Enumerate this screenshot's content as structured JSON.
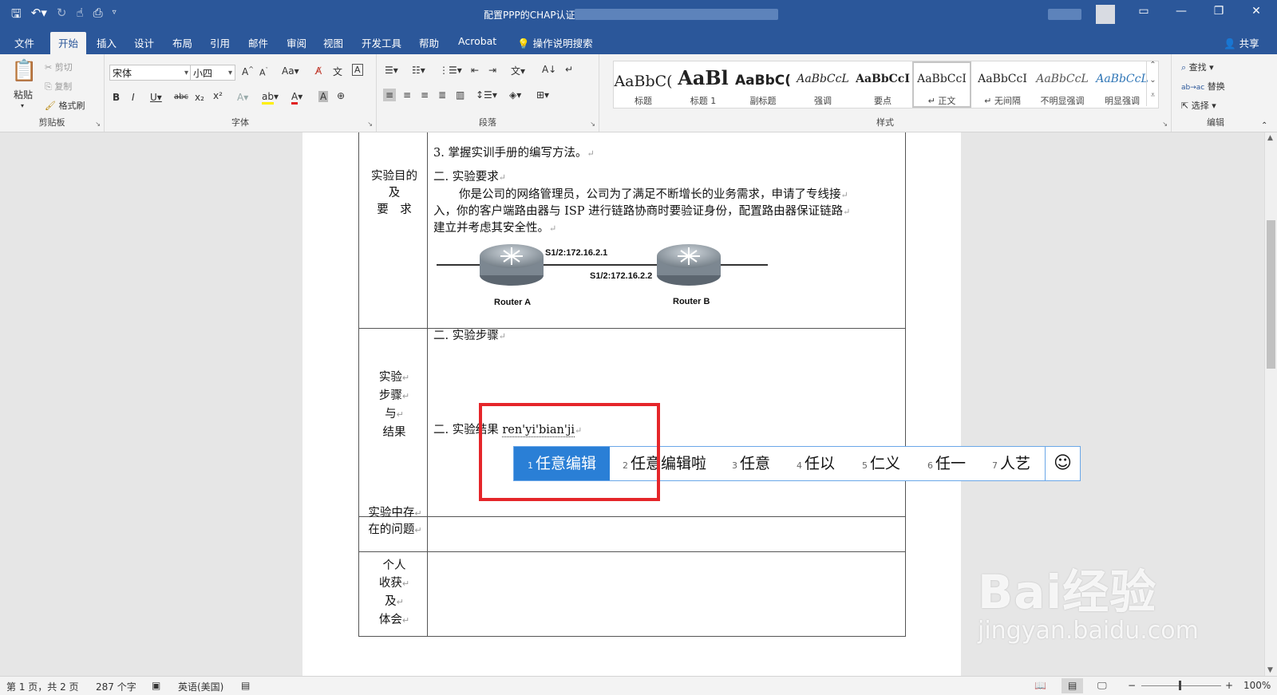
{
  "titlebar": {
    "title": "配置PPP的CHAP认证",
    "window_buttons": [
      "ribbon-display",
      "minimize",
      "restore",
      "close"
    ]
  },
  "tabs": [
    "文件",
    "开始",
    "插入",
    "设计",
    "布局",
    "引用",
    "邮件",
    "审阅",
    "视图",
    "开发工具",
    "帮助",
    "Acrobat"
  ],
  "active_tab": "开始",
  "tell_me": "操作说明搜索",
  "share": "共享",
  "ribbon": {
    "clipboard": {
      "name": "剪贴板",
      "paste": "粘贴",
      "cut": "剪切",
      "copy": "复制",
      "format_painter": "格式刷"
    },
    "font": {
      "name": "字体",
      "font_family": "宋体",
      "font_size": "小四",
      "change_case": "Aa"
    },
    "paragraph": {
      "name": "段落"
    },
    "styles": {
      "name": "样式",
      "items": [
        {
          "preview": "AaBbC(",
          "label": "标题"
        },
        {
          "preview": "AaBl",
          "label": "标题 1"
        },
        {
          "preview": "AaBbC(",
          "label": "副标题"
        },
        {
          "preview": "AaBbCcL",
          "label": "强调"
        },
        {
          "preview": "AaBbCcI",
          "label": "要点"
        },
        {
          "preview": "AaBbCcI",
          "label": "↵ 正文"
        },
        {
          "preview": "AaBbCcI",
          "label": "↵ 无间隔"
        },
        {
          "preview": "AaBbCcL",
          "label": "不明显强调"
        },
        {
          "preview": "AaBbCcL",
          "label": "明显强调"
        }
      ]
    },
    "editing": {
      "name": "编辑",
      "find": "查找",
      "replace": "替换",
      "select": "选择"
    }
  },
  "document": {
    "row1_label": [
      "实验目的",
      "及",
      "要　求"
    ],
    "item3": "3. 掌握实训手册的编写方法。",
    "req_title": "二. 实验要求",
    "req_para": [
      "你是公司的网络管理员，公司为了满足不断增长的业务需求，申请了专线接",
      "入，你的客户端路由器与 ISP 进行链路协商时要验证身份，配置路由器保证链路",
      "建立并考虑其安全性。"
    ],
    "diagram": {
      "ip_a": "S1/2:172.16.2.1",
      "ip_b": "S1/2:172.16.2.2",
      "router_a": "Router A",
      "router_b": "Router B"
    },
    "row2_label": [
      "实验",
      "步骤",
      "与",
      "结果"
    ],
    "steps_title": "二. 实验步骤",
    "result_prefix": "二. 实验结果",
    "ime_composition": "ren'yi'bian'ji",
    "row3_label": [
      "实验中存",
      "在的问题"
    ],
    "row4_label": [
      "个人",
      "收获",
      "及",
      "体会"
    ]
  },
  "ime": {
    "candidates": [
      {
        "num": "1",
        "text": "任意编辑"
      },
      {
        "num": "2",
        "text": "任意编辑啦"
      },
      {
        "num": "3",
        "text": "任意"
      },
      {
        "num": "4",
        "text": "任以"
      },
      {
        "num": "5",
        "text": "仁义"
      },
      {
        "num": "6",
        "text": "任一"
      },
      {
        "num": "7",
        "text": "人艺"
      }
    ],
    "selected_index": 0,
    "emoji": "☺"
  },
  "status": {
    "page": "第 1 页，共 2 页",
    "words": "287 个字",
    "language": "英语(美国)",
    "zoom": "100%"
  },
  "watermark": {
    "brand": "Bai经验",
    "url": "jingyan.baidu.com"
  }
}
